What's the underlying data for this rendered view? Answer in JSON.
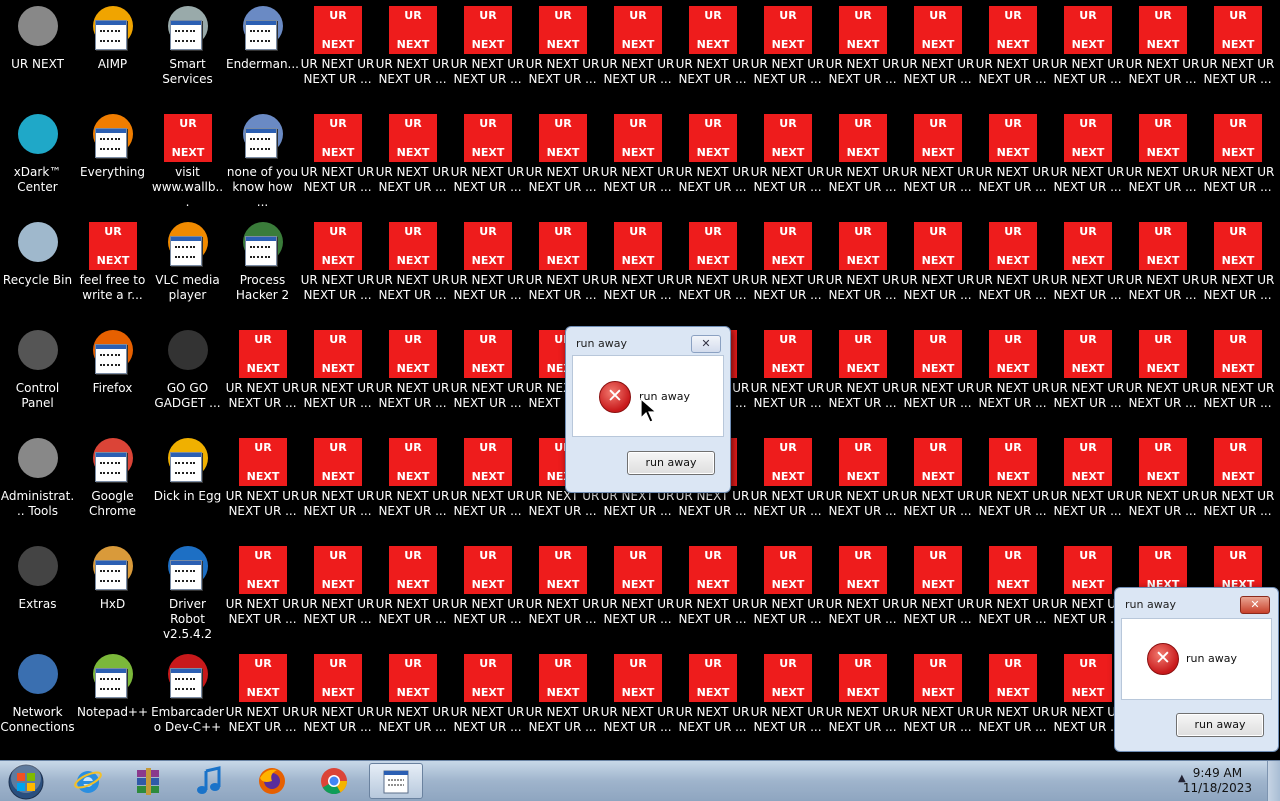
{
  "desktop": {
    "fixed_icons": [
      {
        "label": "UR NEXT",
        "icon": "doll-icon",
        "col": 0,
        "row": 0
      },
      {
        "label": "AIMP",
        "icon": "aimp-icon",
        "col": 1,
        "row": 0
      },
      {
        "label": "Smart Services",
        "icon": "gear-exe-icon",
        "col": 2,
        "row": 0
      },
      {
        "label": "Enderman...",
        "icon": "exe-icon",
        "col": 3,
        "row": 0
      },
      {
        "label": "xDark™ Center",
        "icon": "xdark-icon",
        "col": 0,
        "row": 1
      },
      {
        "label": "Everything",
        "icon": "everything-icon",
        "col": 1,
        "row": 1
      },
      {
        "label": "visit www.wallb...",
        "icon": "urnext-icon",
        "col": 2,
        "row": 1
      },
      {
        "label": "none of you know how ...",
        "icon": "exe-icon",
        "col": 3,
        "row": 1
      },
      {
        "label": "Recycle Bin",
        "icon": "recycle-bin-icon",
        "col": 0,
        "row": 2
      },
      {
        "label": "feel free to write a r...",
        "icon": "urnext-icon",
        "col": 1,
        "row": 2
      },
      {
        "label": "VLC media player",
        "icon": "vlc-icon",
        "col": 2,
        "row": 2
      },
      {
        "label": "Process Hacker 2",
        "icon": "process-hacker-icon",
        "col": 3,
        "row": 2
      },
      {
        "label": "Control Panel",
        "icon": "control-panel-icon",
        "col": 0,
        "row": 3
      },
      {
        "label": "Firefox",
        "icon": "firefox-icon",
        "col": 1,
        "row": 3
      },
      {
        "label": "GO GO GADGET ...",
        "icon": "gadget-icon",
        "col": 2,
        "row": 3
      },
      {
        "label": "Administrat... Tools",
        "icon": "admin-tools-icon",
        "col": 0,
        "row": 4
      },
      {
        "label": "Google Chrome",
        "icon": "chrome-icon",
        "col": 1,
        "row": 4
      },
      {
        "label": "Dick in Egg",
        "icon": "egg-icon",
        "col": 2,
        "row": 4
      },
      {
        "label": "Extras",
        "icon": "extras-icon",
        "col": 0,
        "row": 5
      },
      {
        "label": "HxD",
        "icon": "hxd-icon",
        "col": 1,
        "row": 5
      },
      {
        "label": "Driver Robot v2.5.4.2",
        "icon": "driver-robot-icon",
        "col": 2,
        "row": 5
      },
      {
        "label": "Network Connections",
        "icon": "network-icon",
        "col": 0,
        "row": 6
      },
      {
        "label": "Notepad++",
        "icon": "notepadpp-icon",
        "col": 1,
        "row": 6
      },
      {
        "label": "Embarcadero Dev-C++",
        "icon": "devcpp-icon",
        "col": 2,
        "row": 6
      }
    ],
    "urnext_label": "UR NEXT UR NEXT UR ...",
    "urnext_box_top": "UR",
    "urnext_box_bottom": "NEXT",
    "urnext_start_cols": [
      4,
      4,
      4,
      3,
      3,
      3,
      3
    ],
    "urnext_end_col": 16
  },
  "dialogs": [
    {
      "id": "dialog-center",
      "title": "run away",
      "message": "run away",
      "button": "run away",
      "close": "✕"
    },
    {
      "id": "dialog-right",
      "title": "run away",
      "message": "run away",
      "button": "run away",
      "close": "✕"
    }
  ],
  "taskbar": {
    "items": [
      {
        "name": "start-button",
        "icon": "windows-orb-icon"
      },
      {
        "name": "taskbar-internet-explorer",
        "icon": "ie-icon"
      },
      {
        "name": "taskbar-winrar",
        "icon": "winrar-icon"
      },
      {
        "name": "taskbar-music",
        "icon": "music-note-icon"
      },
      {
        "name": "taskbar-firefox",
        "icon": "firefox-icon"
      },
      {
        "name": "taskbar-chrome",
        "icon": "chrome-icon"
      },
      {
        "name": "taskbar-active-app",
        "icon": "exe-icon"
      }
    ],
    "tray_arrow": "▲",
    "time": "9:49 AM",
    "date": "11/18/2023"
  },
  "colors": {
    "urnext_red": "#ee1c1c",
    "desktop_bg": "#000000"
  }
}
